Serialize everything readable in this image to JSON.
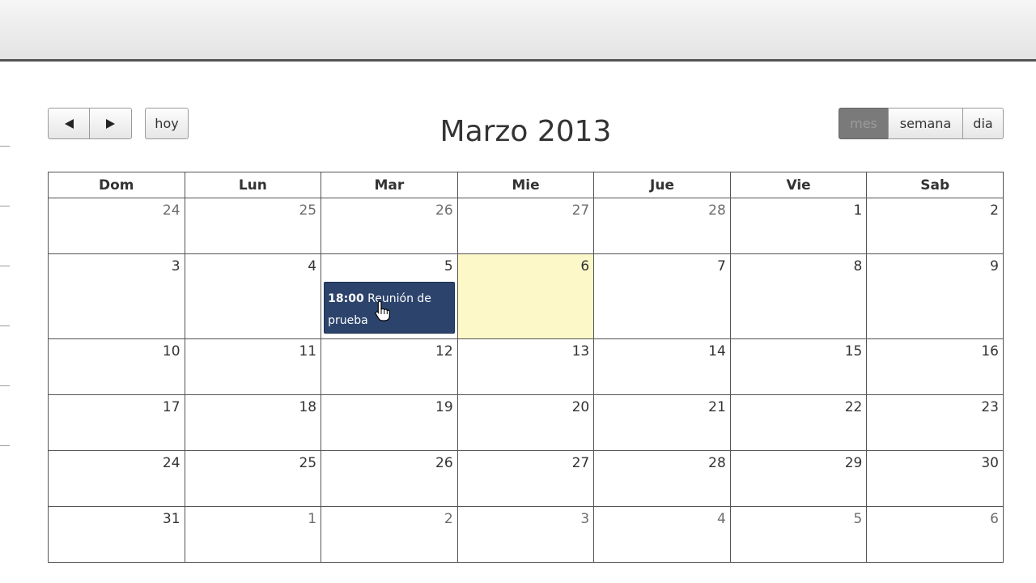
{
  "toolbar": {
    "prev_label": "◄",
    "next_label": "►",
    "today_label": "hoy",
    "views": [
      "mes",
      "semana",
      "dia"
    ],
    "active_view": "mes"
  },
  "calendar": {
    "title": "Marzo 2013",
    "weekdays": [
      "Dom",
      "Lun",
      "Mar",
      "Mie",
      "Jue",
      "Vie",
      "Sab"
    ],
    "weeks": [
      [
        "24",
        "25",
        "26",
        "27",
        "28",
        "1",
        "2"
      ],
      [
        "3",
        "4",
        "5",
        "6",
        "7",
        "8",
        "9"
      ],
      [
        "10",
        "11",
        "12",
        "13",
        "14",
        "15",
        "16"
      ],
      [
        "17",
        "18",
        "19",
        "20",
        "21",
        "22",
        "23"
      ],
      [
        "24",
        "25",
        "26",
        "27",
        "28",
        "29",
        "30"
      ],
      [
        "31",
        "1",
        "2",
        "3",
        "4",
        "5",
        "6"
      ]
    ],
    "today": "6"
  },
  "event": {
    "time": "18:00",
    "title": "Reunión de prueba"
  },
  "colors": {
    "event_bg": "#2c436c",
    "today_bg": "#fcf8c8",
    "active_view_bg": "#7a7a7a"
  },
  "icons": {
    "prev": "triangle-left-icon",
    "next": "triangle-right-icon",
    "cursor": "hand-pointer-icon"
  }
}
